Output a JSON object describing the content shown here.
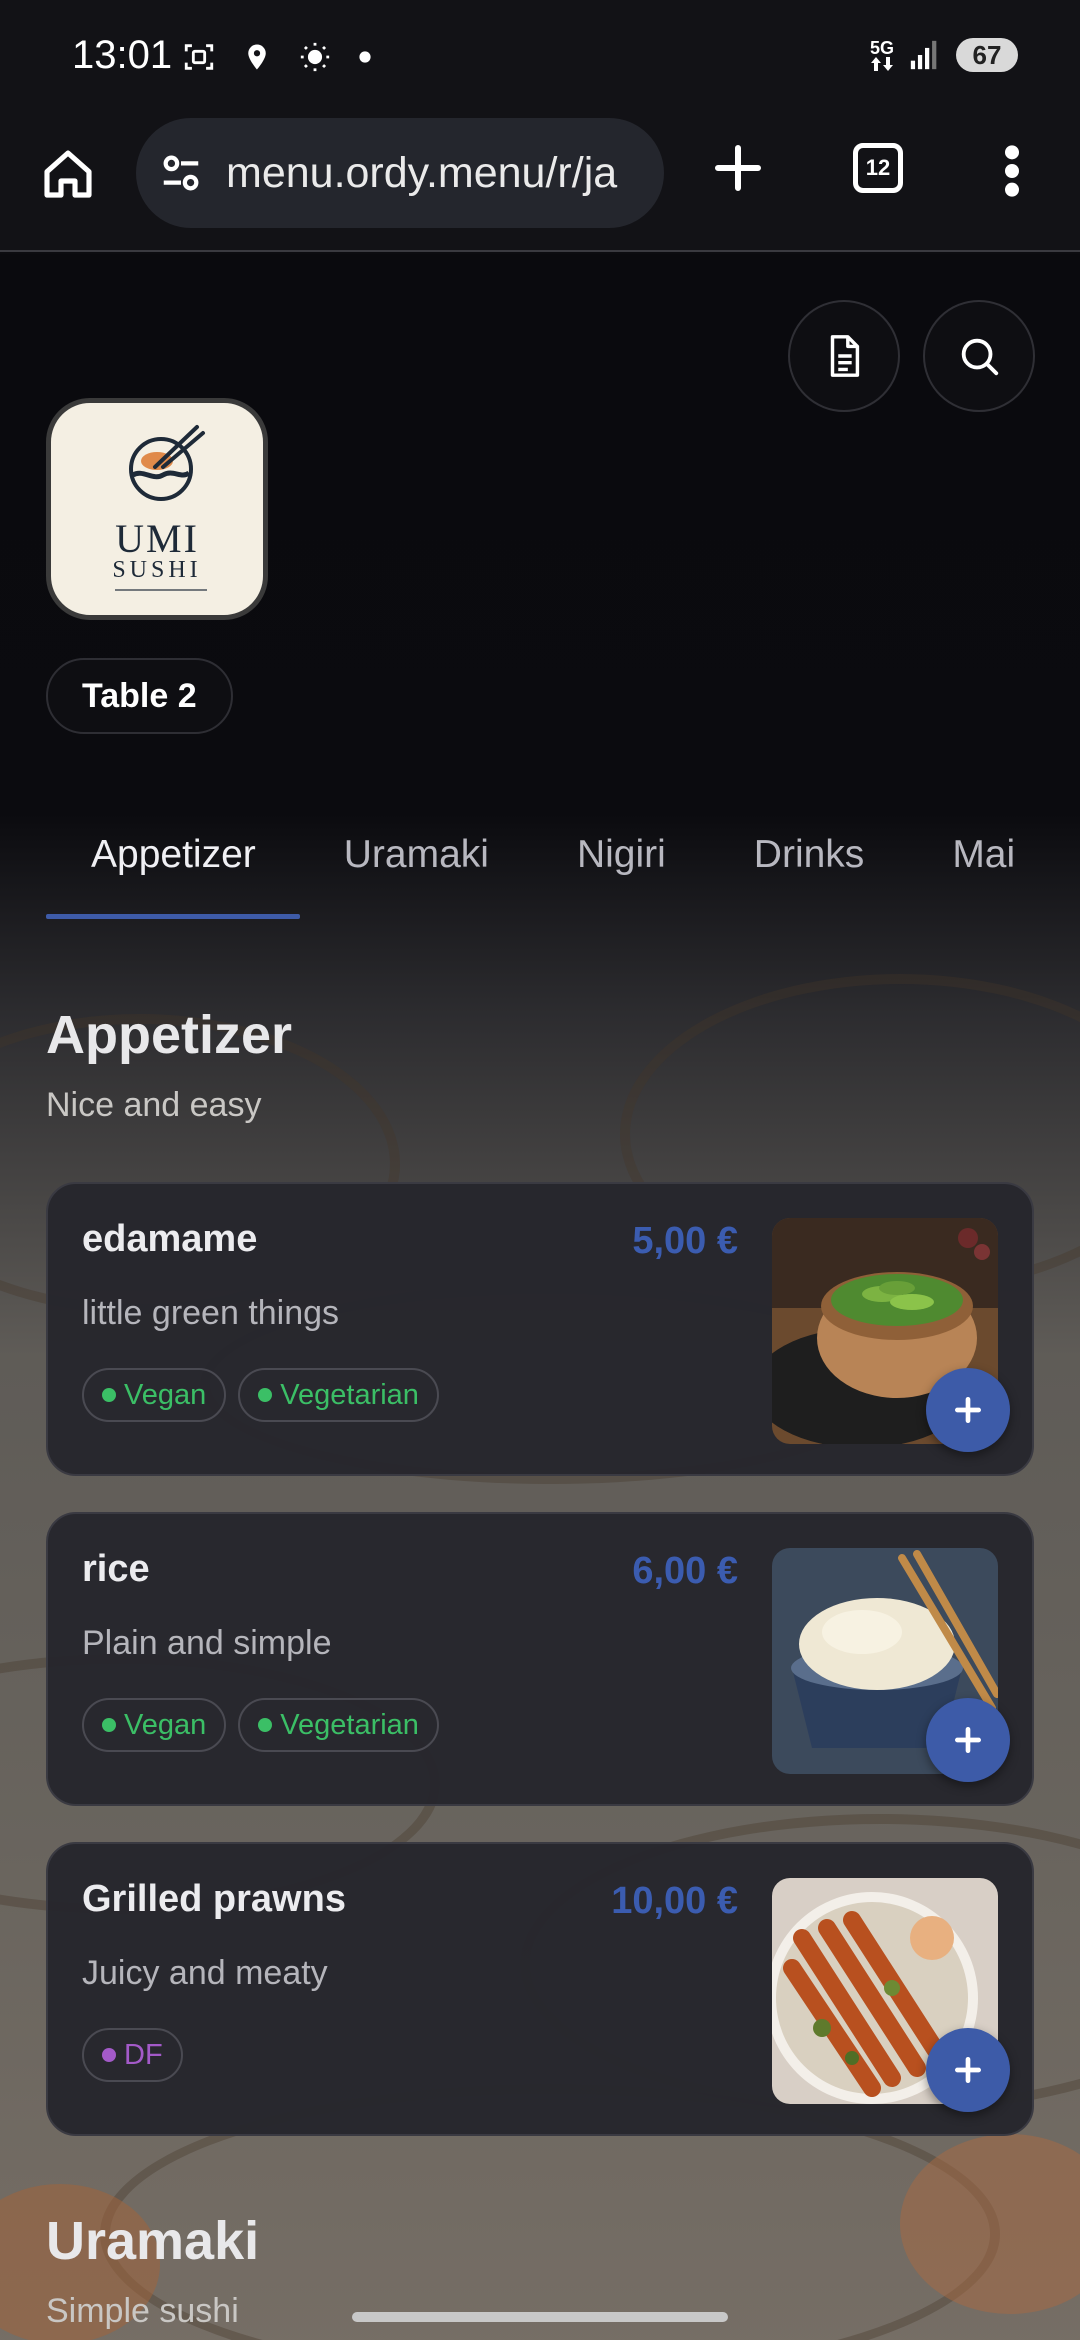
{
  "status_bar": {
    "time": "13:01",
    "network": "5G",
    "battery": "67"
  },
  "browser": {
    "url": "menu.ordy.menu/r/ja",
    "tab_count": "12"
  },
  "restaurant": {
    "logo_name_line1": "UMI",
    "logo_name_line2": "SUSHI",
    "table_label": "Table 2"
  },
  "categories": [
    "Appetizer",
    "Uramaki",
    "Nigiri",
    "Drinks",
    "Mai"
  ],
  "active_category": "Appetizer",
  "sections": [
    {
      "title": "Appetizer",
      "subtitle": "Nice and easy",
      "items": [
        {
          "name": "edamame",
          "price": "5,00 €",
          "description": "little green things",
          "tags": [
            "Vegan",
            "Vegetarian"
          ]
        },
        {
          "name": "rice",
          "price": "6,00 €",
          "description": "Plain and simple",
          "tags": [
            "Vegan",
            "Vegetarian"
          ]
        },
        {
          "name": "Grilled prawns",
          "price": "10,00 €",
          "description": "Juicy and meaty",
          "tags": [
            "DF"
          ]
        }
      ]
    },
    {
      "title": "Uramaki",
      "subtitle": "Simple sushi"
    }
  ],
  "colors": {
    "accent": "#3d5ba8",
    "tag_green": "#3bbf66",
    "tag_purple": "#a35ac8"
  },
  "icons": {
    "add": "plus-icon",
    "menu_doc": "document-icon",
    "search": "search-icon"
  }
}
